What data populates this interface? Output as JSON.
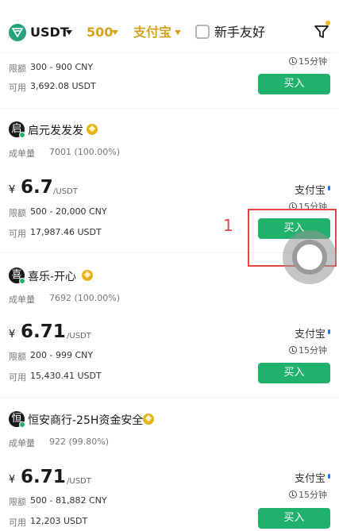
{
  "header": {
    "asset": "USDT",
    "amount": "500",
    "payment": "支付宝",
    "newbie_label": "新手友好"
  },
  "top_partial": {
    "limit_label": "限额",
    "limit": "300 - 900 CNY",
    "available_label": "可用",
    "available": "3,692.08 USDT",
    "time": "15分钟",
    "buy_label": "买入"
  },
  "listings": [
    {
      "avatar_char": "启",
      "name": "启元发发发",
      "volume_label": "成单量",
      "volume": "7001 (100.00%)",
      "currency": "¥",
      "price": "6.7",
      "unit": "/USDT",
      "limit_label": "限额",
      "limit": "500 - 20,000 CNY",
      "available_label": "可用",
      "available": "17,987.46 USDT",
      "payment": "支付宝",
      "time": "15分钟",
      "buy_label": "买入"
    },
    {
      "avatar_char": "喜",
      "name": "喜乐-开心",
      "volume_label": "成单量",
      "volume": "7692 (100.00%)",
      "currency": "¥",
      "price": "6.71",
      "unit": "/USDT",
      "limit_label": "限额",
      "limit": "200 - 999 CNY",
      "available_label": "可用",
      "available": "15,430.41 USDT",
      "payment": "支付宝",
      "time": "15分钟",
      "buy_label": "买入"
    },
    {
      "avatar_char": "恒",
      "name": "恒安商行-25H资金安全",
      "volume_label": "成单量",
      "volume": "922 (99.80%)",
      "currency": "¥",
      "price": "6.71",
      "unit": "/USDT",
      "limit_label": "限额",
      "limit": "500 - 81,882 CNY",
      "available_label": "可用",
      "available": "12,203 USDT",
      "payment": "支付宝",
      "time": "15分钟",
      "buy_label": "买入"
    }
  ],
  "annotation": {
    "marker": "1"
  },
  "colors": {
    "accent_gold": "#d4a21c",
    "buy_green": "#20b26c",
    "annotation_red": "#e64545"
  },
  "icons": [
    "usdt-icon",
    "chevron-down-icon",
    "checkbox-icon",
    "filter-icon",
    "clock-icon",
    "verified-badge-icon",
    "online-dot-icon"
  ]
}
